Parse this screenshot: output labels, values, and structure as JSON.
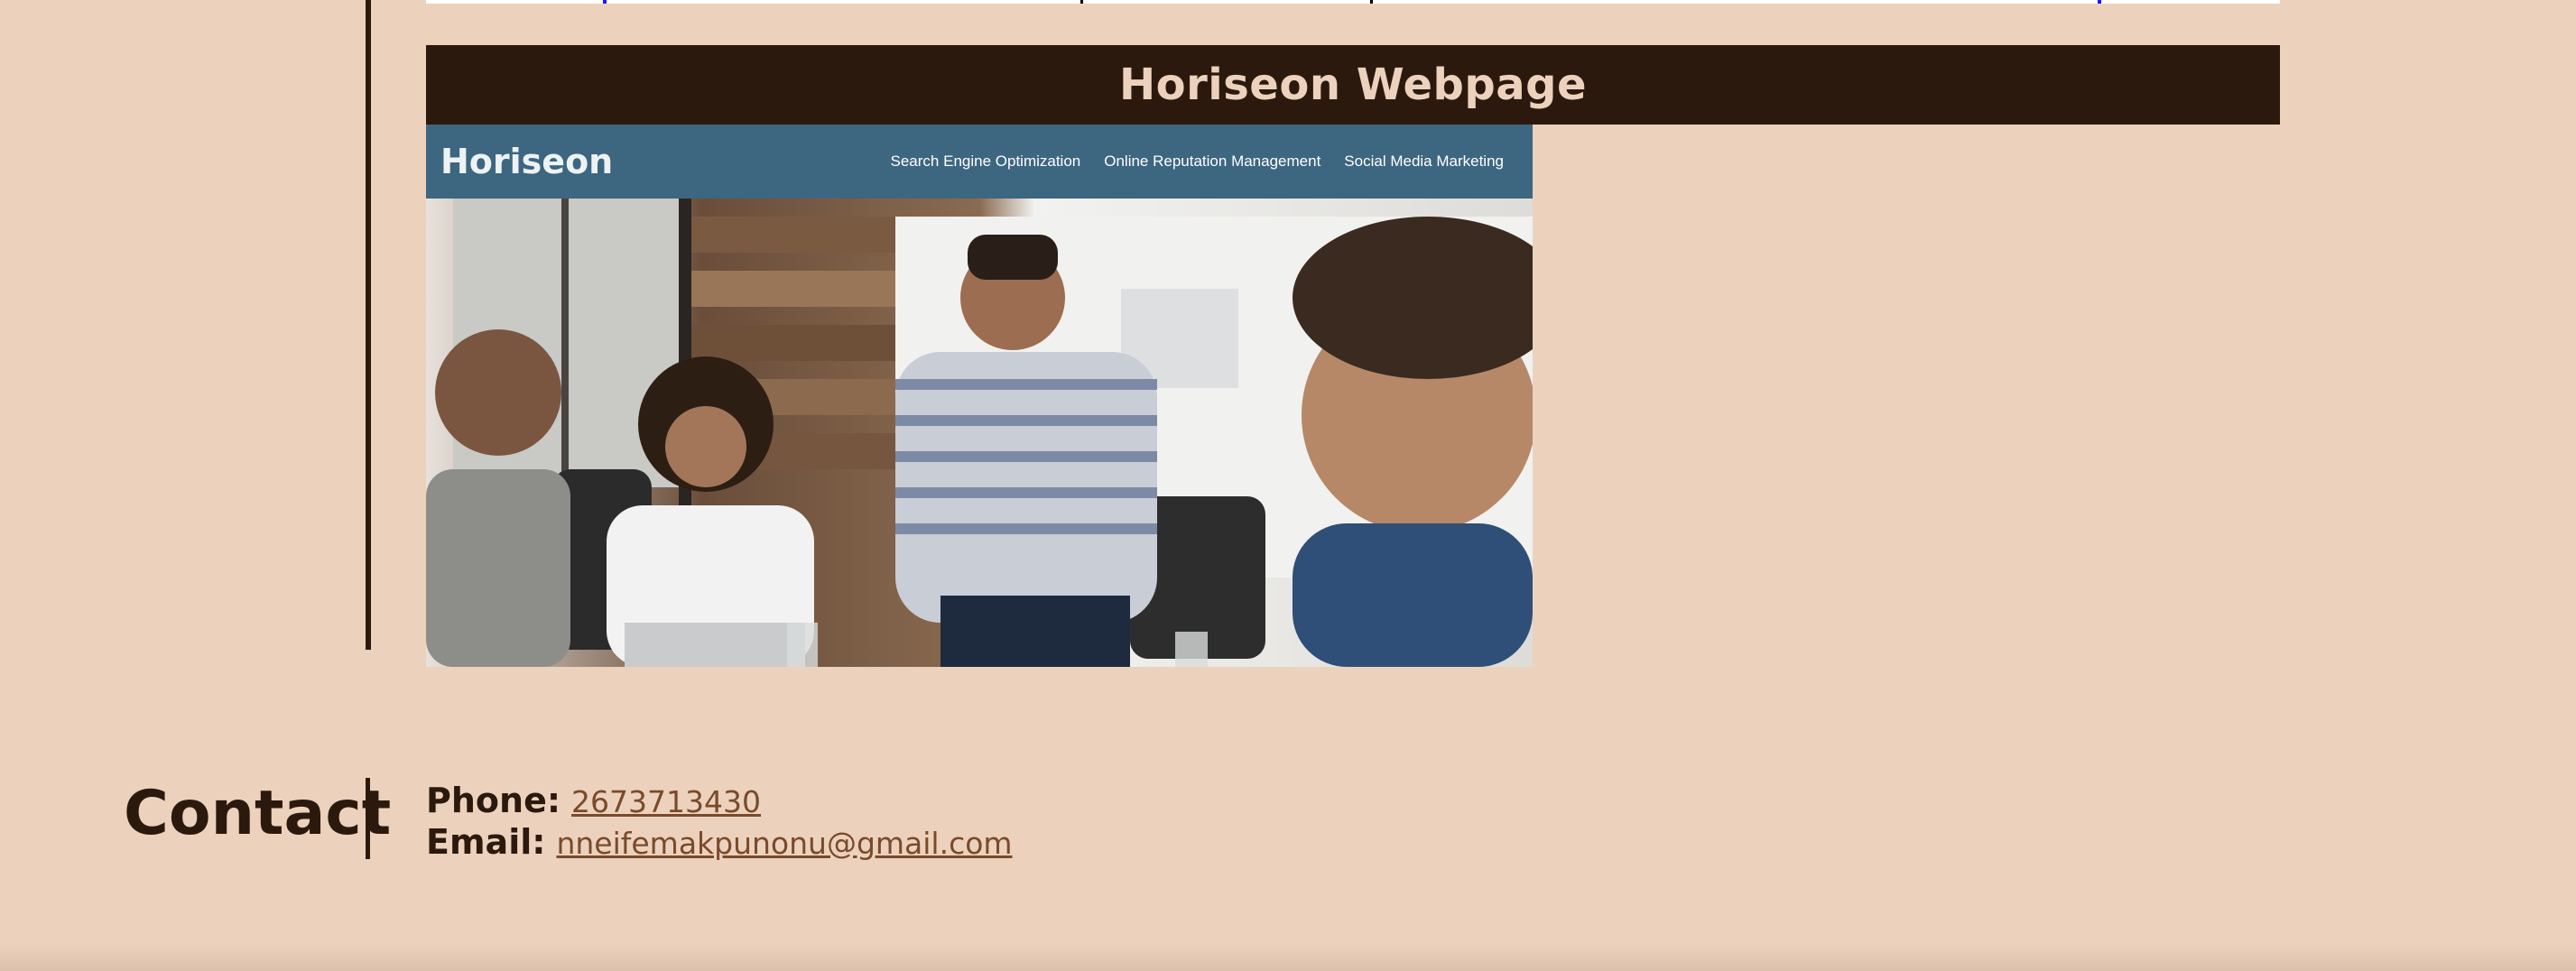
{
  "page": {
    "title": "Horiseon Webpage"
  },
  "embedded_screenshot": {
    "logo": "Horiseon",
    "nav": [
      "Search Engine Optimization",
      "Online Reputation Management",
      "Social Media Marketing"
    ],
    "header_color": "#3d6680",
    "photo_icon": "team-meeting-photo"
  },
  "contact": {
    "heading": "Contact",
    "phone_label": "Phone:",
    "phone_value": "2673713430",
    "email_label": "Email:",
    "email_value": "nneifemakpunonu@gmail.com"
  },
  "colors": {
    "background": "#ecd2bc",
    "dark_brown": "#2c190e",
    "link": "#7a4a2c"
  }
}
